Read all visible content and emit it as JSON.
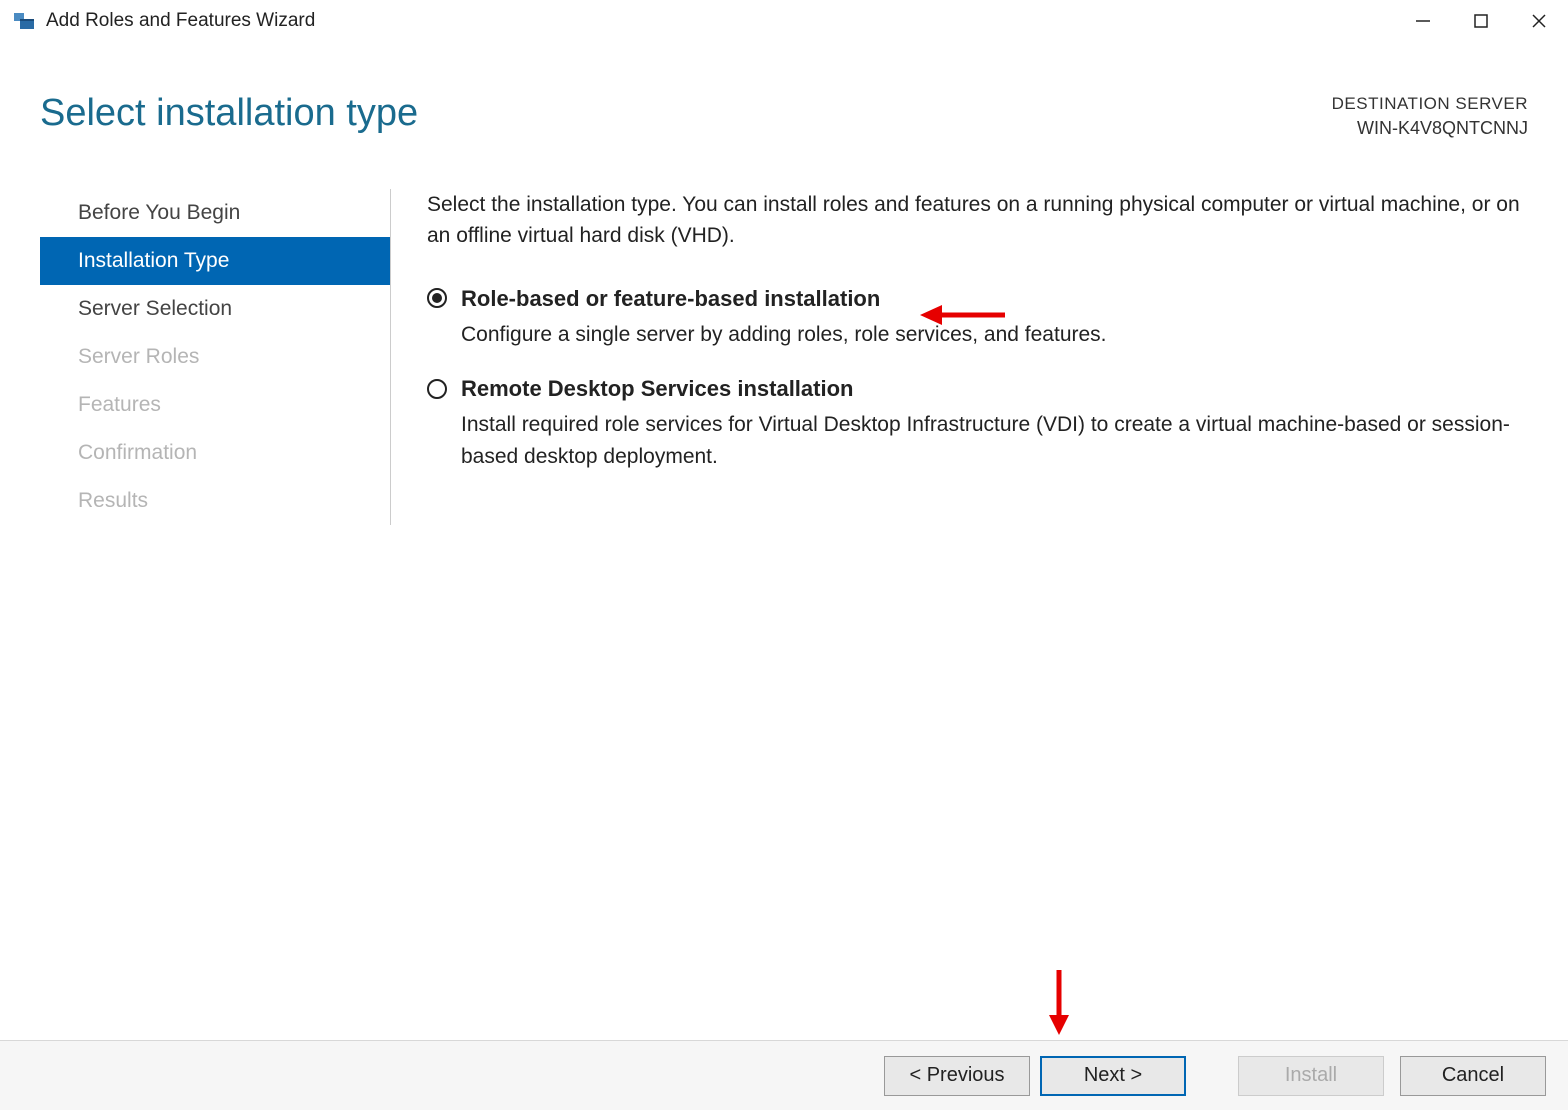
{
  "titlebar": {
    "title": "Add Roles and Features Wizard"
  },
  "header": {
    "pageTitle": "Select installation type",
    "destLabel": "DESTINATION SERVER",
    "destServer": "WIN-K4V8QNTCNNJ"
  },
  "sidebar": {
    "items": [
      {
        "label": "Before You Begin",
        "state": "normal"
      },
      {
        "label": "Installation Type",
        "state": "active"
      },
      {
        "label": "Server Selection",
        "state": "normal"
      },
      {
        "label": "Server Roles",
        "state": "disabled"
      },
      {
        "label": "Features",
        "state": "disabled"
      },
      {
        "label": "Confirmation",
        "state": "disabled"
      },
      {
        "label": "Results",
        "state": "disabled"
      }
    ]
  },
  "content": {
    "intro": "Select the installation type. You can install roles and features on a running physical computer or virtual machine, or on an offline virtual hard disk (VHD).",
    "options": [
      {
        "title": "Role-based or feature-based installation",
        "desc": "Configure a single server by adding roles, role services, and features.",
        "selected": true
      },
      {
        "title": "Remote Desktop Services installation",
        "desc": "Install required role services for Virtual Desktop Infrastructure (VDI) to create a virtual machine-based or session-based desktop deployment.",
        "selected": false
      }
    ]
  },
  "footer": {
    "previous": "< Previous",
    "next": "Next >",
    "install": "Install",
    "cancel": "Cancel"
  }
}
